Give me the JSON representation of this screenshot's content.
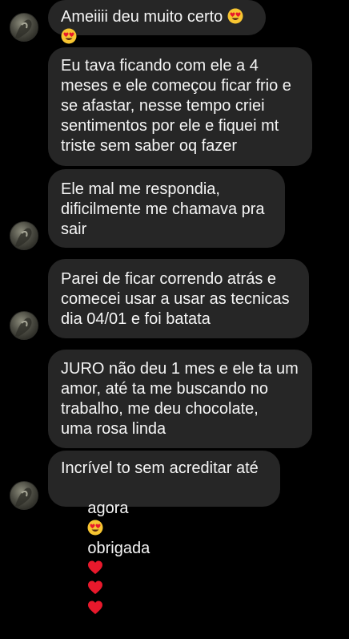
{
  "messages": [
    {
      "text": "Ameiiii deu muito certo",
      "emojis": [
        "heart-eyes",
        "heart-eyes"
      ]
    },
    {
      "text": "Eu tava ficando com ele a 4\nmeses e ele começou ficar frio e\nse afastar, nesse tempo criei\nsentimentos por ele e fiquei mt\ntriste sem saber oq fazer"
    },
    {
      "text": "Ele mal me respondia,\ndificilmente me chamava pra\nsair"
    },
    {
      "text": "Parei de ficar correndo atrás e\ncomecei usar a usar as tecnicas\ndia 04/01 e foi batata"
    },
    {
      "text": "JURO não deu 1 mes e ele ta um\namor, até ta me buscando no\ntrabalho, me deu chocolate,\numa rosa linda"
    },
    {
      "text_line1": "Incrível to sem acreditar até",
      "text_line2": "agora",
      "text_line2b": "obrigada",
      "emojis": [
        "heart-eyes",
        "red-heart",
        "red-heart",
        "red-heart"
      ]
    }
  ],
  "colors": {
    "background": "#000000",
    "bubble": "#262626",
    "text": "#f5f5f5",
    "heart": "#e8192c",
    "emoji_face": "#f7c531"
  }
}
